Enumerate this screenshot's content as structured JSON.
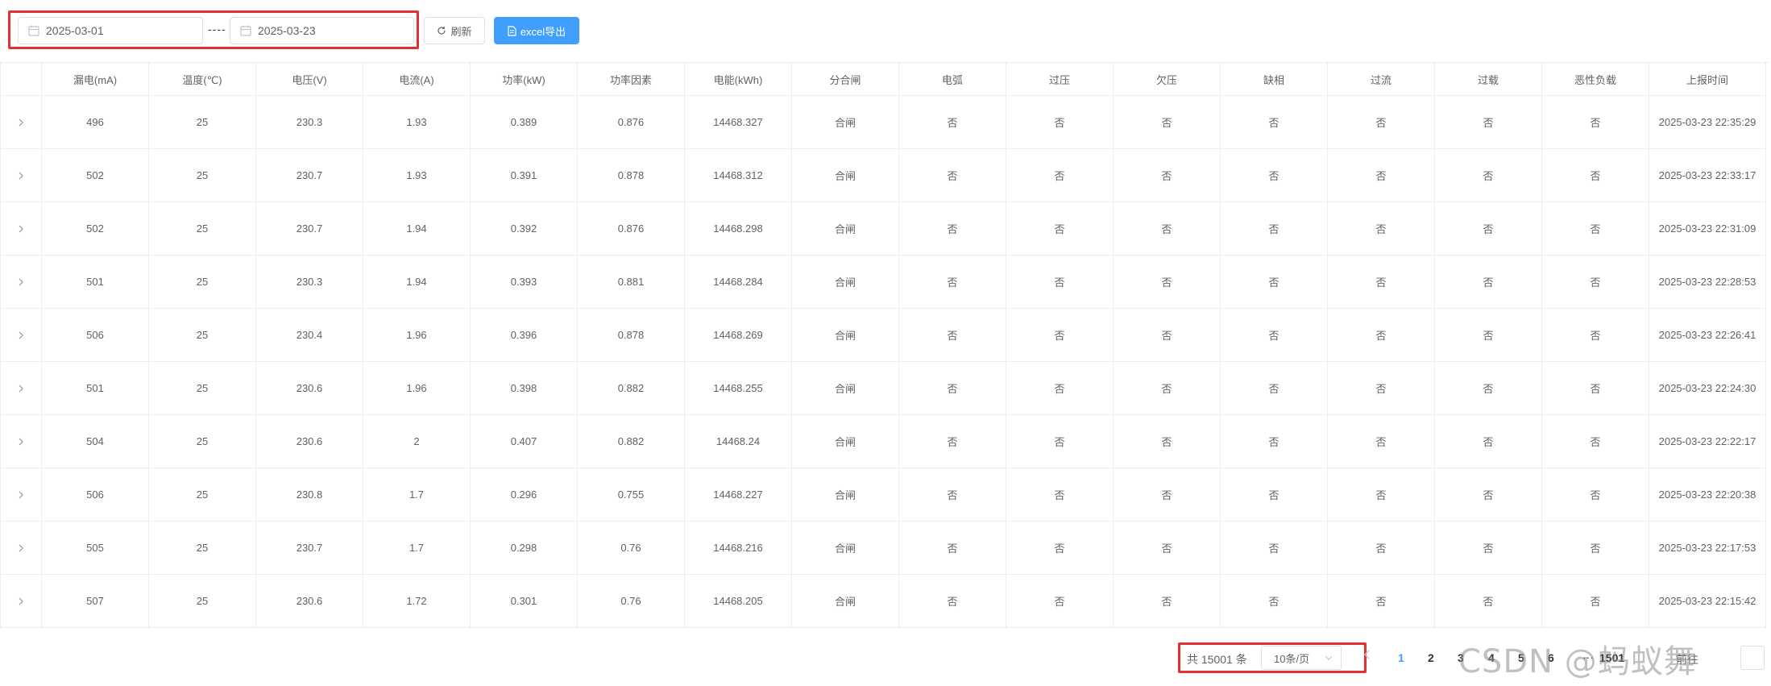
{
  "toolbar": {
    "start_date": "2025-03-01",
    "separator": "----",
    "end_date": "2025-03-23",
    "refresh_label": "刷新",
    "export_label": "excel导出"
  },
  "table": {
    "headers": [
      "漏电(mA)",
      "温度(℃)",
      "电压(V)",
      "电流(A)",
      "功率(kW)",
      "功率因素",
      "电能(kWh)",
      "分合闸",
      "电弧",
      "过压",
      "欠压",
      "缺相",
      "过流",
      "过载",
      "恶性负载",
      "上报时间"
    ],
    "rows": [
      [
        "496",
        "25",
        "230.3",
        "1.93",
        "0.389",
        "0.876",
        "14468.327",
        "合闸",
        "否",
        "否",
        "否",
        "否",
        "否",
        "否",
        "否",
        "2025-03-23 22:35:29"
      ],
      [
        "502",
        "25",
        "230.7",
        "1.93",
        "0.391",
        "0.878",
        "14468.312",
        "合闸",
        "否",
        "否",
        "否",
        "否",
        "否",
        "否",
        "否",
        "2025-03-23 22:33:17"
      ],
      [
        "502",
        "25",
        "230.7",
        "1.94",
        "0.392",
        "0.876",
        "14468.298",
        "合闸",
        "否",
        "否",
        "否",
        "否",
        "否",
        "否",
        "否",
        "2025-03-23 22:31:09"
      ],
      [
        "501",
        "25",
        "230.3",
        "1.94",
        "0.393",
        "0.881",
        "14468.284",
        "合闸",
        "否",
        "否",
        "否",
        "否",
        "否",
        "否",
        "否",
        "2025-03-23 22:28:53"
      ],
      [
        "506",
        "25",
        "230.4",
        "1.96",
        "0.396",
        "0.878",
        "14468.269",
        "合闸",
        "否",
        "否",
        "否",
        "否",
        "否",
        "否",
        "否",
        "2025-03-23 22:26:41"
      ],
      [
        "501",
        "25",
        "230.6",
        "1.96",
        "0.398",
        "0.882",
        "14468.255",
        "合闸",
        "否",
        "否",
        "否",
        "否",
        "否",
        "否",
        "否",
        "2025-03-23 22:24:30"
      ],
      [
        "504",
        "25",
        "230.6",
        "2",
        "0.407",
        "0.882",
        "14468.24",
        "合闸",
        "否",
        "否",
        "否",
        "否",
        "否",
        "否",
        "否",
        "2025-03-23 22:22:17"
      ],
      [
        "506",
        "25",
        "230.8",
        "1.7",
        "0.296",
        "0.755",
        "14468.227",
        "合闸",
        "否",
        "否",
        "否",
        "否",
        "否",
        "否",
        "否",
        "2025-03-23 22:20:38"
      ],
      [
        "505",
        "25",
        "230.7",
        "1.7",
        "0.298",
        "0.76",
        "14468.216",
        "合闸",
        "否",
        "否",
        "否",
        "否",
        "否",
        "否",
        "否",
        "2025-03-23 22:17:53"
      ],
      [
        "507",
        "25",
        "230.6",
        "1.72",
        "0.301",
        "0.76",
        "14468.205",
        "合闸",
        "否",
        "否",
        "否",
        "否",
        "否",
        "否",
        "否",
        "2025-03-23 22:15:42"
      ]
    ]
  },
  "pagination": {
    "total": "共 15001 条",
    "page_size": "10条/页",
    "pages": [
      "1",
      "2",
      "3",
      "4",
      "5",
      "6"
    ],
    "ellipsis": "···",
    "last_page": "1501",
    "goto_label": "前往"
  },
  "watermark": "CSDN @蚂蚁舞",
  "colors": {
    "primary": "#409eff",
    "highlight": "#e03030",
    "border": "#ebeef5"
  }
}
